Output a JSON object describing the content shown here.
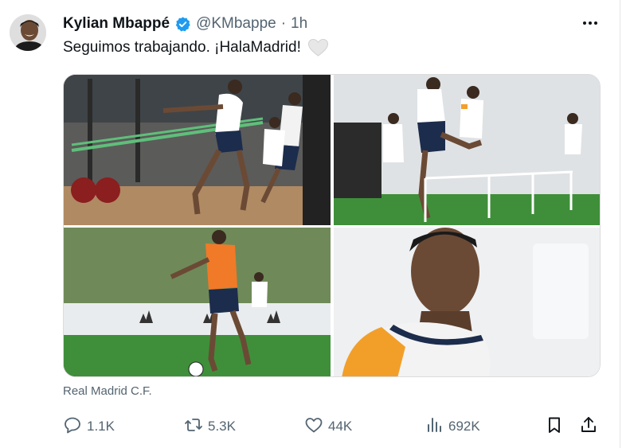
{
  "author": {
    "name": "Kylian Mbappé",
    "handle": "@KMbappe",
    "separator": "·",
    "time": "1h"
  },
  "tweet": {
    "text": "Seguimos trabajando. ¡HalaMadrid!"
  },
  "media": {
    "source": "Real Madrid C.F."
  },
  "actions": {
    "replies": "1.1K",
    "retweets": "5.3K",
    "likes": "44K",
    "views": "692K"
  },
  "icons": {
    "verified": "verified-badge-icon",
    "more": "more-icon",
    "reply": "reply-icon",
    "retweet": "retweet-icon",
    "like": "heart-icon",
    "views": "views-icon",
    "bookmark": "bookmark-icon",
    "share": "share-icon"
  },
  "colors": {
    "verified": "#1d9bf0",
    "text": "#0f1419",
    "secondary": "#536471"
  }
}
